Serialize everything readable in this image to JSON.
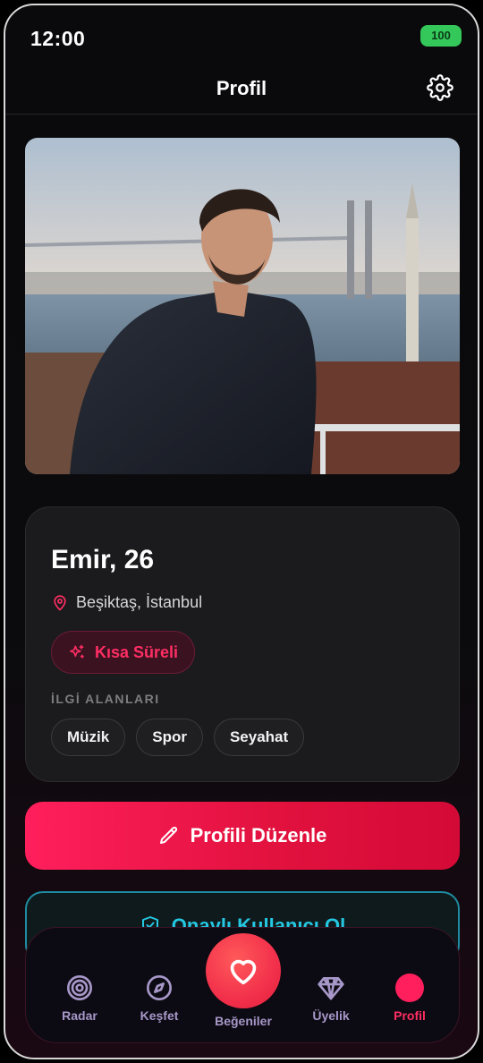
{
  "status": {
    "time": "12:00",
    "battery": "100"
  },
  "header": {
    "title": "Profil",
    "settings_icon": "gear-icon"
  },
  "profile": {
    "name": "Emir, 26",
    "location": "Beşiktaş, İstanbul",
    "tag": "Kısa Süreli",
    "interests_title": "İLGİ ALANLARI",
    "interests": [
      "Müzik",
      "Spor",
      "Seyahat"
    ]
  },
  "actions": {
    "edit_label": "Profili Düzenle",
    "verify_label": "Onaylı Kullanıcı Ol"
  },
  "nav": {
    "items": [
      {
        "label": "Radar",
        "icon": "target-icon"
      },
      {
        "label": "Keşfet",
        "icon": "compass-icon"
      },
      {
        "label": "Beğeniler",
        "icon": "heart-icon"
      },
      {
        "label": "Üyelik",
        "icon": "diamond-icon"
      },
      {
        "label": "Profil",
        "icon": "profile-icon"
      }
    ],
    "active": "Profil"
  },
  "colors": {
    "accent": "#ff1f5c",
    "verify": "#25c6e0",
    "nav_text": "#a798c9"
  }
}
